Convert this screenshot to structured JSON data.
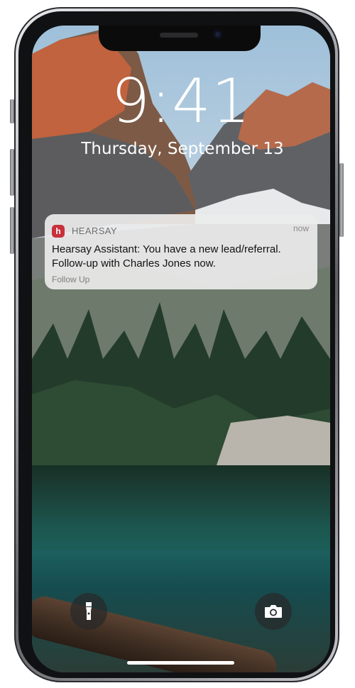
{
  "lock_screen": {
    "time": "9:41",
    "date": "Thursday, September 13"
  },
  "notification": {
    "app_icon": "hearsay-app-icon",
    "app_icon_letter": "h",
    "app_name": "HEARSAY",
    "time": "now",
    "message": "Hearsay Assistant: You have a new lead/referral. Follow-up with Charles Jones now.",
    "action": "Follow Up",
    "colors": {
      "icon": "#c8303b"
    }
  },
  "quick_actions": {
    "flashlight_icon": "flashlight-icon",
    "camera_icon": "camera-icon"
  }
}
